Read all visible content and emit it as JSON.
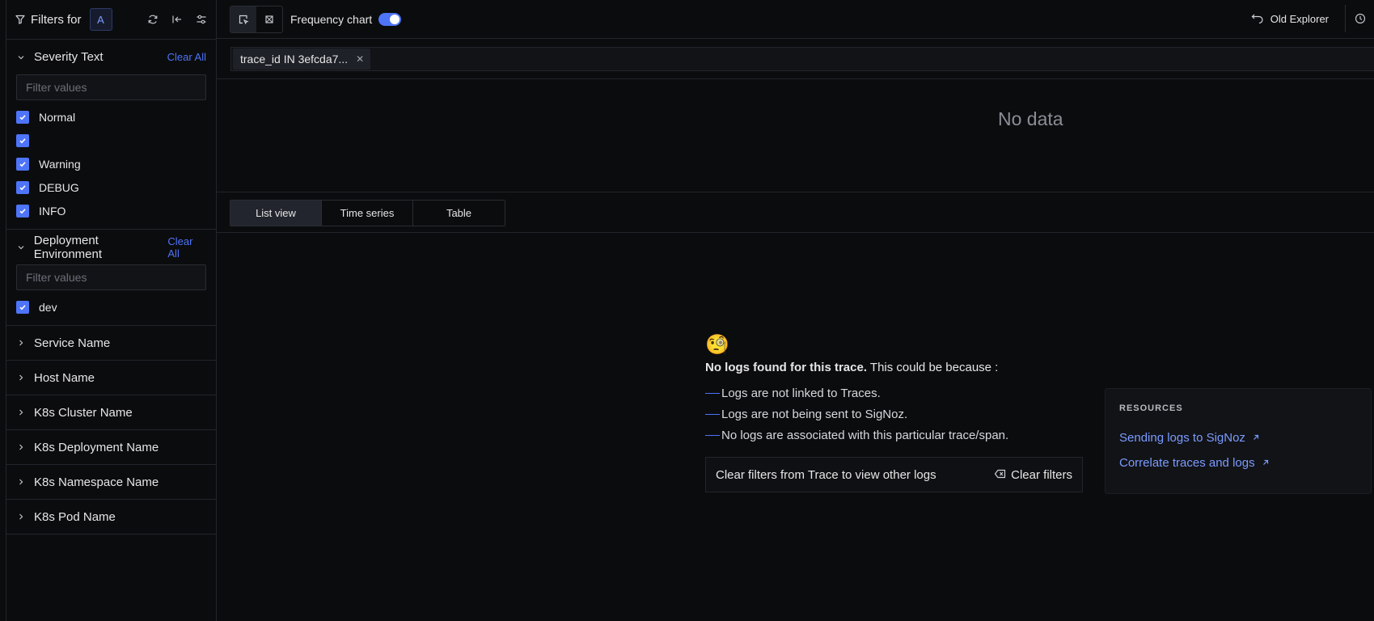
{
  "sidebar": {
    "title": "Filters for",
    "badge": "A",
    "sections": [
      {
        "title": "Severity Text",
        "clear": "Clear All",
        "placeholder": "Filter values",
        "options": [
          "Normal",
          "",
          "Warning",
          "DEBUG",
          "INFO"
        ]
      },
      {
        "title": "Deployment Environment",
        "clear": "Clear All",
        "placeholder": "Filter values",
        "options": [
          "dev"
        ]
      }
    ],
    "collapsed": [
      "Service Name",
      "Host Name",
      "K8s Cluster Name",
      "K8s Deployment Name",
      "K8s Namespace Name",
      "K8s Pod Name"
    ]
  },
  "topbar": {
    "frequency_label": "Frequency chart",
    "frequency_enabled": true,
    "old_explorer": "Old Explorer"
  },
  "query": {
    "chip": "trace_id IN 3efcda7..."
  },
  "chart": {
    "no_data": "No data"
  },
  "tabs": [
    "List view",
    "Time series",
    "Table"
  ],
  "empty": {
    "emoji": "🧐",
    "title_bold": "No logs found for this trace.",
    "title_rest": " This could be because :",
    "reasons": [
      "Logs are not linked to Traces.",
      "Logs are not being sent to SigNoz.",
      "No logs are associated with this particular trace/span."
    ],
    "clear_text": "Clear filters from Trace to view other logs",
    "clear_button": "Clear filters"
  },
  "resources": {
    "title": "RESOURCES",
    "links": [
      "Sending logs to SigNoz",
      "Correlate traces and logs"
    ]
  },
  "colors": {
    "accent": "#4e74f8",
    "link": "#7b9bff",
    "background": "#0b0c0e"
  }
}
